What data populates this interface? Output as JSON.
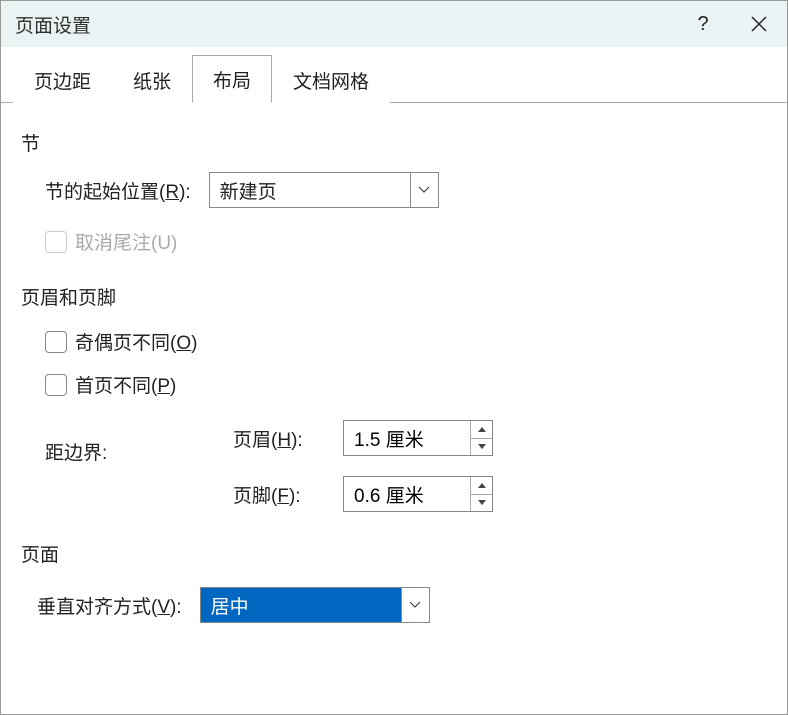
{
  "titlebar": {
    "title": "页面设置"
  },
  "tabs": {
    "margin": "页边距",
    "paper": "纸张",
    "layout": "布局",
    "grid": "文档网格"
  },
  "section": {
    "group_title": "节",
    "start_label_pre": "节的起始位置(",
    "start_label_u": "R",
    "start_label_post": "):",
    "start_value": "新建页",
    "suppress_endnotes": "取消尾注(U)"
  },
  "headerfooter": {
    "group_title": "页眉和页脚",
    "oddeven_pre": "奇偶页不同(",
    "oddeven_u": "O",
    "oddeven_post": ")",
    "firstpage_pre": "首页不同(",
    "firstpage_u": "P",
    "firstpage_post": ")",
    "distance_label": "距边界:",
    "header_label_pre": "页眉(",
    "header_label_u": "H",
    "header_label_post": "):",
    "header_value": "1.5 厘米",
    "footer_label_pre": "页脚(",
    "footer_label_u": "F",
    "footer_label_post": "):",
    "footer_value": "0.6 厘米"
  },
  "page": {
    "group_title": "页面",
    "valign_label_pre": "垂直对齐方式(",
    "valign_label_u": "V",
    "valign_label_post": "):",
    "valign_value": "居中"
  }
}
